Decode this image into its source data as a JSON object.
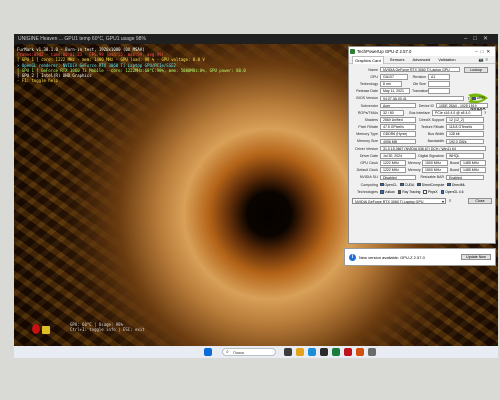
{
  "app": {
    "title": "UNIGINE Heaven ... GPU1 temp 60°C, GPU1 usage 98%"
  },
  "osd_lines": [
    {
      "text": "FurMark v1.38.1.0 - Burn-in test, 1920x1080 (0X MSAA)",
      "color": "white"
    },
    {
      "text": "Frames:8942 - time:00:01:23 - FPS:99 (min:55, max:99, avg:99)",
      "color": "red"
    },
    {
      "text": "[ GPU 1 ] core: 1222 MHz - mem: 1400 MHz - GPU load: 98 % - GPU voltage: 0.0 V",
      "color": "yellow"
    },
    {
      "text": "> OpenGL renderer: NVIDIA GeForce RTX 3060 Ti Laptop GPU/PCIe/SSE2",
      "color": "cyan"
    },
    {
      "text": "[ GPU 1 ] GeForce RTX 3060 Ti Mobile - core: 1222MHz:60°C:98%, mem: 5000MHz:0%, GPU power: 80.0",
      "color": "green"
    },
    {
      "text": "[ GPU 2 ] Intel(R) UHD Graphics",
      "color": "white"
    },
    {
      "text": "- F1: toggle help",
      "color": "white"
    }
  ],
  "bottom_osd": [
    "GPU: 60°C | Usage: 98%",
    "Ctrl+I: toggle info | ESC: exit"
  ],
  "gpuz": {
    "title": "TechPowerUp GPU-Z 2.57.0",
    "tabs": [
      "Graphics Card",
      "Sensors",
      "Advanced",
      "Validation"
    ],
    "lookup_label": "Lookup",
    "rows": {
      "name": {
        "label": "Name",
        "value": "NVIDIA GeForce RTX 3060 Ti Laptop GPU"
      },
      "gpu": {
        "label": "GPU",
        "value": "GA107",
        "label2": "Revision",
        "value2": "A1"
      },
      "technology": {
        "label": "Technology",
        "value": "8 nm",
        "label2": "Die Size",
        "value2": ""
      },
      "release": {
        "label": "Release Date",
        "value": "May 11, 2021",
        "label2": "Transistors",
        "value2": ""
      },
      "bios": {
        "label": "BIOS Version",
        "value": "94.07.3A.00.41",
        "uefi": "UEFI"
      },
      "subvendor": {
        "label": "Subvendor",
        "value": "Acer",
        "label2": "Device ID",
        "value2": "10DE 25A0 - 1025 1519"
      },
      "rops": {
        "label": "ROPs/TMUs",
        "value": "32 / 80",
        "label2": "Bus Interface",
        "value2": "PCIe x16 4.0 @ x8 4.0"
      },
      "shaders": {
        "label": "Shaders",
        "value": "2560 Unified",
        "label2": "DirectX Support",
        "value2": "12 (12_2)"
      },
      "pixel": {
        "label": "Pixel Fillrate",
        "value": "47.5 GPixel/s",
        "label2": "Texture Fillrate",
        "value2": "118.8 GTexel/s"
      },
      "memtype": {
        "label": "Memory Type",
        "value": "GDDR6 (Hynix)",
        "label2": "Bus Width",
        "value2": "128 bit"
      },
      "memsize": {
        "label": "Memory Size",
        "value": "4096 MB",
        "label2": "Bandwidth",
        "value2": "192.0 GB/s"
      },
      "driver": {
        "label": "Driver Version",
        "value": "31.0.15.3667 (NVIDIA 536.67) DCH / Win11 64"
      },
      "driverdate": {
        "label": "Driver Date",
        "value": "Jul 30, 2024",
        "label2": "Digital Signature",
        "value2": "WHQL"
      },
      "gpuclock": {
        "label": "GPU Clock",
        "value": "1222 MHz",
        "label2": "Memory",
        "value2": "1500 MHz",
        "label3": "Boost",
        "value3": "1485 MHz"
      },
      "defclock": {
        "label": "Default Clock",
        "value": "1222 MHz",
        "label2": "Memory",
        "value2": "1500 MHz",
        "label3": "Boost",
        "value3": "1485 MHz"
      },
      "sli": {
        "label": "NVIDIA SLI",
        "value": "Disabled",
        "label2": "Resizable BAR",
        "value2": "Enabled"
      }
    },
    "computing": {
      "label": "Computing",
      "items": [
        {
          "name": "OpenCL",
          "checked": true
        },
        {
          "name": "CUDA",
          "checked": true
        },
        {
          "name": "DirectCompute",
          "checked": true
        },
        {
          "name": "DirectML",
          "checked": true
        }
      ]
    },
    "technologies": {
      "label": "Technologies",
      "items": [
        {
          "name": "Vulkan",
          "checked": true
        },
        {
          "name": "Ray Tracing",
          "checked": true
        },
        {
          "name": "PhysX",
          "checked": false
        },
        {
          "name": "OpenGL 4.6",
          "checked": true
        }
      ]
    },
    "selected_gpu": "NVIDIA GeForce RTX 3060 Ti Laptop GPU",
    "close_label": "Close"
  },
  "notification": {
    "message": "New version available: GPU-Z 2.57.0",
    "button": "Update Now"
  },
  "taskbar": {
    "search_placeholder": "Поиск"
  },
  "colors": {
    "osd_white": "#ffffff",
    "osd_red": "#ff5050",
    "osd_yellow": "#ffe24a",
    "osd_cyan": "#5cf0ff",
    "osd_green": "#b2ff6a",
    "nvidia_green": "#76b900"
  }
}
